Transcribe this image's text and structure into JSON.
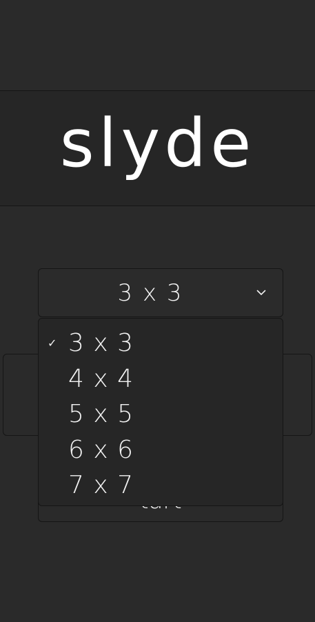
{
  "app": {
    "logo_text": "slyde"
  },
  "size_select": {
    "selected": "3 x 3",
    "options": [
      {
        "label": "3 x 3",
        "checked": true
      },
      {
        "label": "4 x 4",
        "checked": false
      },
      {
        "label": "5 x 5",
        "checked": false
      },
      {
        "label": "6 x 6",
        "checked": false
      },
      {
        "label": "7 x 7",
        "checked": false
      }
    ],
    "check_glyph": "✓"
  },
  "obscured_button": {
    "visible_text": "tart"
  },
  "colors": {
    "background": "#2a2a2a",
    "header_band": "#262626",
    "text": "#f2f2f2",
    "border": "#151515"
  }
}
